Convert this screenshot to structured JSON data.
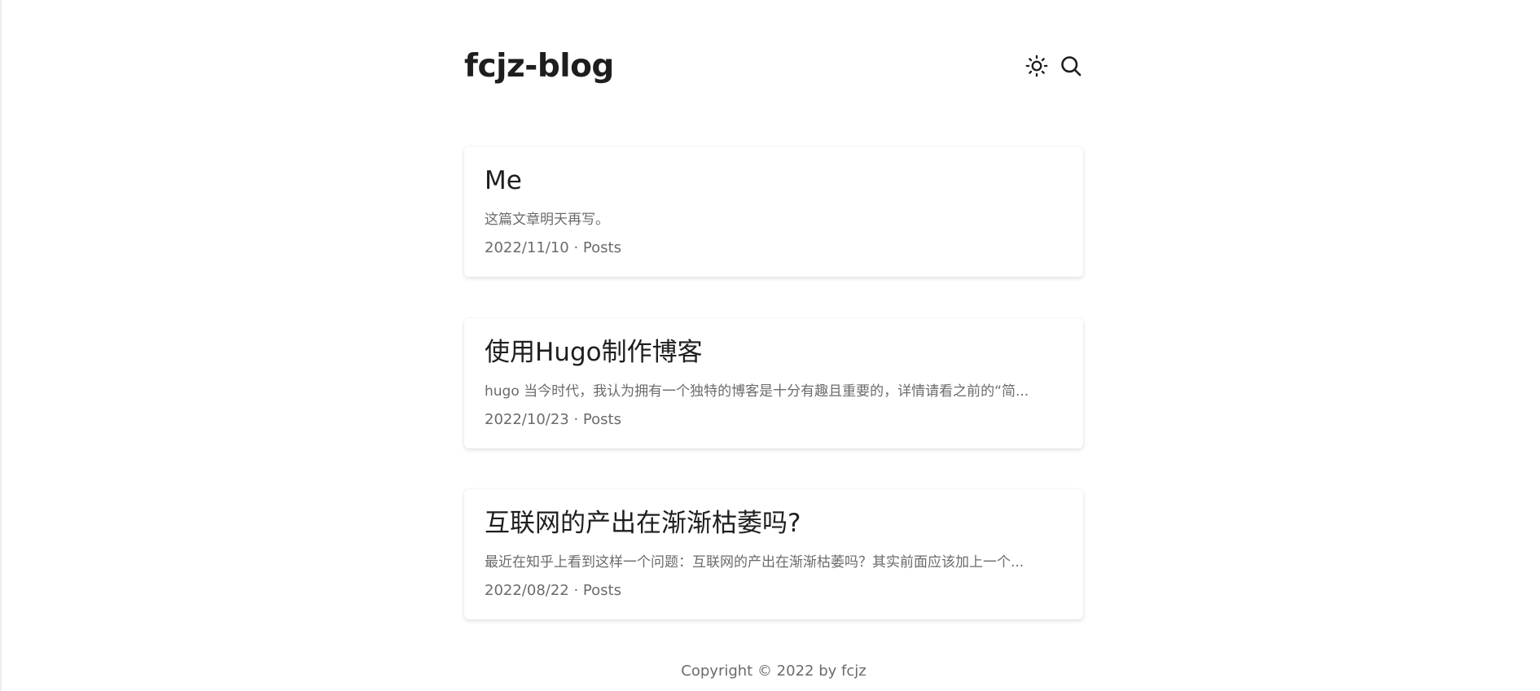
{
  "header": {
    "site_title": "fcjz-blog",
    "theme_toggle_icon": "sun-icon",
    "search_icon": "search-icon"
  },
  "posts": [
    {
      "title": "Me",
      "summary": "这篇文章明天再写。",
      "meta": "2022/11/10 · Posts"
    },
    {
      "title": "使用Hugo制作博客",
      "summary": "hugo 当今时代，我认为拥有一个独特的博客是十分有趣且重要的，详情请看之前的“简...",
      "meta": "2022/10/23 · Posts"
    },
    {
      "title": "互联网的产出在渐渐枯萎吗?",
      "summary": "最近在知乎上看到这样一个问题：互联网的产出在渐渐枯萎吗？其实前面应该加上一个...",
      "meta": "2022/08/22 · Posts"
    }
  ],
  "footer": {
    "copyright": "Copyright © 2022 by fcjz"
  },
  "colors": {
    "text_primary": "#1e1e1e",
    "text_secondary": "#6b6b6b",
    "background": "#ffffff"
  }
}
